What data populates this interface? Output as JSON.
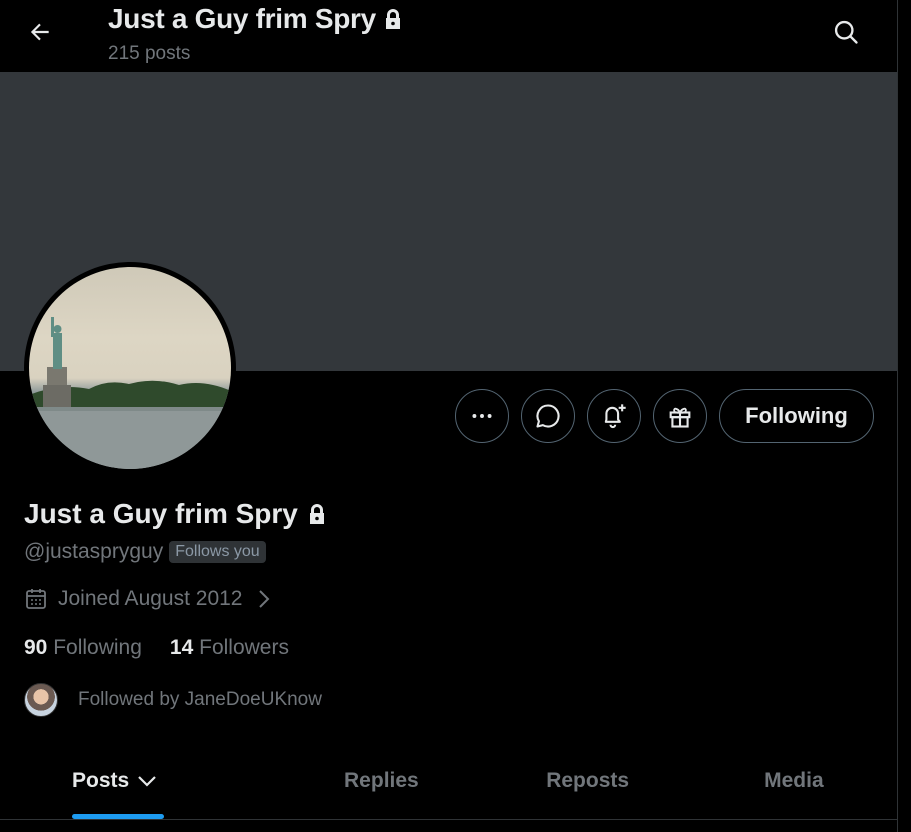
{
  "header": {
    "title": "Just a Guy frim Spry",
    "post_count": "215 posts",
    "back_icon": "arrow-left-icon",
    "search_icon": "search-icon"
  },
  "profile": {
    "name": "Just a Guy frim Spry",
    "handle": "@justaspryguy",
    "follows_you_badge": "Follows you",
    "joined": "Joined August 2012",
    "following_count": "90",
    "following_label": "Following",
    "followers_count": "14",
    "followers_label": "Followers",
    "followed_by": "Followed by JaneDoeUKnow",
    "locked": true
  },
  "actions": {
    "more_icon": "more-icon",
    "message_icon": "message-icon",
    "notify_icon": "bell-plus-icon",
    "gift_icon": "gift-icon",
    "following_button": "Following"
  },
  "tabs": [
    {
      "label": "Posts",
      "active": true
    },
    {
      "label": "Replies",
      "active": false
    },
    {
      "label": "Reposts",
      "active": false
    },
    {
      "label": "Media",
      "active": false
    }
  ],
  "colors": {
    "background": "#000000",
    "banner": "#33373b",
    "accent": "#1d9bf0",
    "muted_text": "#71767b"
  }
}
